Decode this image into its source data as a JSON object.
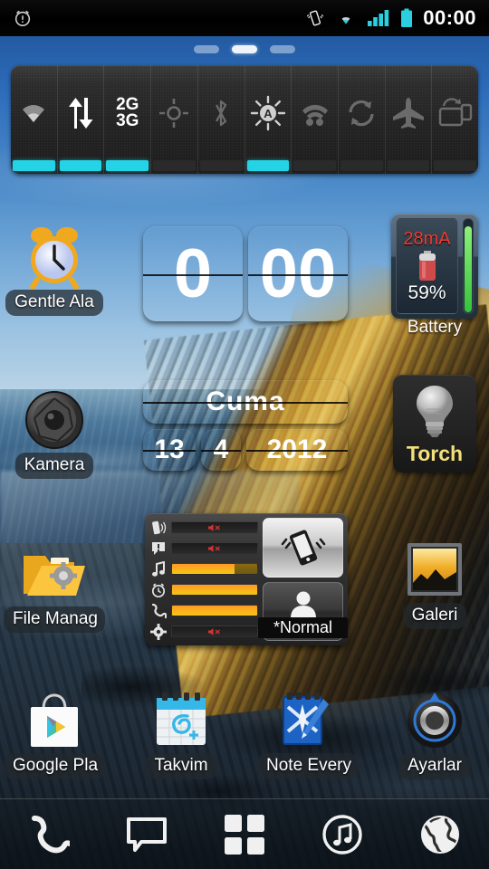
{
  "status_bar": {
    "alarm_icon": "alarm-clock-icon",
    "icons": [
      "vibrate-icon",
      "wifi-icon",
      "signal-bars-icon",
      "battery-icon"
    ],
    "clock": "00:00"
  },
  "page_indicator": {
    "pages": 3,
    "current": 2
  },
  "toggle_widget": {
    "items": [
      {
        "name": "wifi",
        "icon": "wifi-icon",
        "label": "",
        "active": true
      },
      {
        "name": "mobile-data",
        "icon": "data-arrows-icon",
        "label": "",
        "active": true
      },
      {
        "name": "network-mode",
        "icon": "text-icon",
        "label": "2G\n3G",
        "label_top": "2G",
        "label_bottom": "3G",
        "active": true
      },
      {
        "name": "gps",
        "icon": "gps-target-icon",
        "label": "",
        "active": false
      },
      {
        "name": "bluetooth",
        "icon": "bluetooth-icon",
        "label": "",
        "active": false
      },
      {
        "name": "auto-brightness",
        "icon": "brightness-auto-icon",
        "label": "",
        "active": true
      },
      {
        "name": "wifi-hotspot",
        "icon": "hotspot-icon",
        "label": "",
        "active": false
      },
      {
        "name": "auto-sync",
        "icon": "sync-arrows-icon",
        "label": "",
        "active": false
      },
      {
        "name": "airplane-mode",
        "icon": "airplane-icon",
        "label": "",
        "active": false
      },
      {
        "name": "auto-rotate",
        "icon": "screen-rotate-icon",
        "label": "",
        "active": false
      }
    ],
    "active_color": "#24d3e6"
  },
  "clock_widget": {
    "hours": "0",
    "minutes": "00"
  },
  "date_widget": {
    "weekday": "Cuma",
    "day": "13",
    "month": "4",
    "year": "2012"
  },
  "battery_widget": {
    "current": "28mA",
    "percent": "59%",
    "label": "Battery",
    "current_color": "#ef3b30",
    "gauge_color": "#3ec83f",
    "gauge_level": 59
  },
  "torch_widget": {
    "label": "Torch",
    "icon": "lightbulb-icon",
    "label_color": "#f2e07a"
  },
  "volume_widget": {
    "rows": [
      {
        "name": "ringer",
        "icon": "ringer-icon",
        "level": 0,
        "muted": true
      },
      {
        "name": "notification",
        "icon": "notification-bubble-icon",
        "level": 0,
        "muted": true
      },
      {
        "name": "music",
        "icon": "music-note-icon",
        "level": 73,
        "muted": false
      },
      {
        "name": "alarm",
        "icon": "alarm-clock-icon",
        "level": 100,
        "muted": false
      },
      {
        "name": "call",
        "icon": "phone-handset-icon",
        "level": 100,
        "muted": false
      },
      {
        "name": "system",
        "icon": "gear-icon",
        "level": 0,
        "muted": true
      }
    ],
    "vibrate_button": {
      "icon": "phone-vibrate-icon"
    },
    "profile_button": {
      "icon": "person-icon",
      "label": "*Normal"
    }
  },
  "app_icons": [
    {
      "name": "gentle-alarm",
      "label": "Gentle Ala",
      "icon": "alarm-clock-icon"
    },
    {
      "name": "kamera",
      "label": "Kamera",
      "icon": "camera-aperture-icon"
    },
    {
      "name": "file-manager",
      "label": "File Manag",
      "icon": "folder-gear-icon"
    },
    {
      "name": "galeri",
      "label": "Galeri",
      "icon": "picture-frame-icon"
    },
    {
      "name": "google-play",
      "label": "Google Pla",
      "icon": "play-store-bag-icon"
    },
    {
      "name": "takvim",
      "label": "Takvim",
      "icon": "calendar-icon"
    },
    {
      "name": "note-everything",
      "label": "Note Every",
      "icon": "notepad-pen-icon"
    },
    {
      "name": "ayarlar",
      "label": "Ayarlar",
      "icon": "settings-dial-icon"
    }
  ],
  "dock": {
    "items": [
      {
        "name": "phone",
        "icon": "phone-handset-icon"
      },
      {
        "name": "messaging",
        "icon": "speech-bubble-icon"
      },
      {
        "name": "app-drawer",
        "icon": "grid-squares-icon"
      },
      {
        "name": "music",
        "icon": "music-circle-icon"
      },
      {
        "name": "browser",
        "icon": "globe-icon"
      }
    ]
  }
}
